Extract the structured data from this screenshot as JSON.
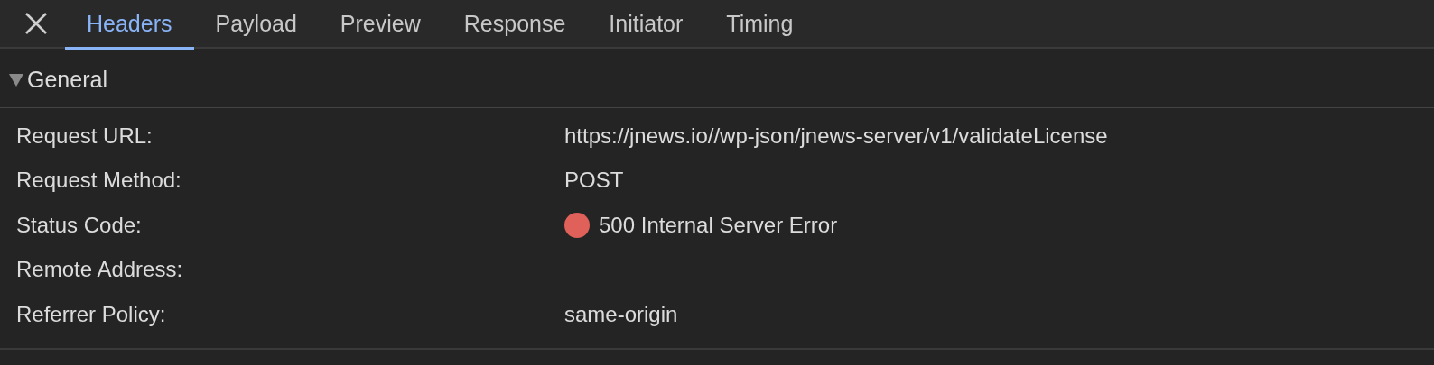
{
  "tabs": [
    {
      "label": "Headers",
      "selected": true
    },
    {
      "label": "Payload",
      "selected": false
    },
    {
      "label": "Preview",
      "selected": false
    },
    {
      "label": "Response",
      "selected": false
    },
    {
      "label": "Initiator",
      "selected": false
    },
    {
      "label": "Timing",
      "selected": false
    }
  ],
  "section": {
    "title": "General",
    "expanded": true,
    "rows": [
      {
        "label": "Request URL:",
        "value": "https://jnews.io//wp-json/jnews-server/v1/validateLicense"
      },
      {
        "label": "Request Method:",
        "value": "POST"
      },
      {
        "label": "Status Code:",
        "value": "500 Internal Server Error",
        "color": "#e0605a"
      },
      {
        "label": "Remote Address:"
      },
      {
        "label": "Referrer Policy:",
        "value": "same-origin"
      }
    ]
  }
}
